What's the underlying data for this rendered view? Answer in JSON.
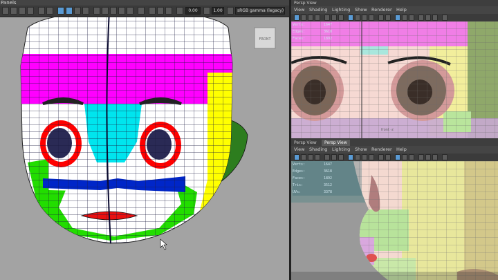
{
  "left": {
    "panel_label": "Panels",
    "toolbar": {
      "value_a": "0.00",
      "value_b": "1.00",
      "colorspace": "sRGB gamma (legacy)"
    },
    "viewcube_label": "FRONT"
  },
  "top_right": {
    "title": "Persp View",
    "menu": [
      "View",
      "Shading",
      "Lighting",
      "Show",
      "Renderer",
      "Help"
    ],
    "camera_label": "front -z",
    "hud": [
      {
        "label": "Verts:",
        "value": "1647"
      },
      {
        "label": "Edges:",
        "value": "3618"
      },
      {
        "label": "Faces:",
        "value": "1892"
      }
    ]
  },
  "bottom_right": {
    "tabs": [
      "Persp View",
      "Persp View"
    ],
    "menu": [
      "View",
      "Shading",
      "Lighting",
      "Show",
      "Renderer",
      "Help"
    ],
    "hud": [
      {
        "label": "Verts:",
        "value": "1647"
      },
      {
        "label": "Edges:",
        "value": "3618"
      },
      {
        "label": "Faces:",
        "value": "1892"
      },
      {
        "label": "Tris:",
        "value": "3512"
      },
      {
        "label": "UVs:",
        "value": "3378"
      }
    ]
  },
  "colors": {
    "viewport_bg": "#a3a3a3",
    "selection_blue": "#5a9bd5",
    "face_magenta": "#ff00ff",
    "face_cyan": "#00e5ee",
    "face_yellow": "#ffff00",
    "face_green": "#22dd00",
    "face_red": "#ff0000",
    "face_blue": "#0026c8",
    "ear_green": "#2d7d1e"
  }
}
